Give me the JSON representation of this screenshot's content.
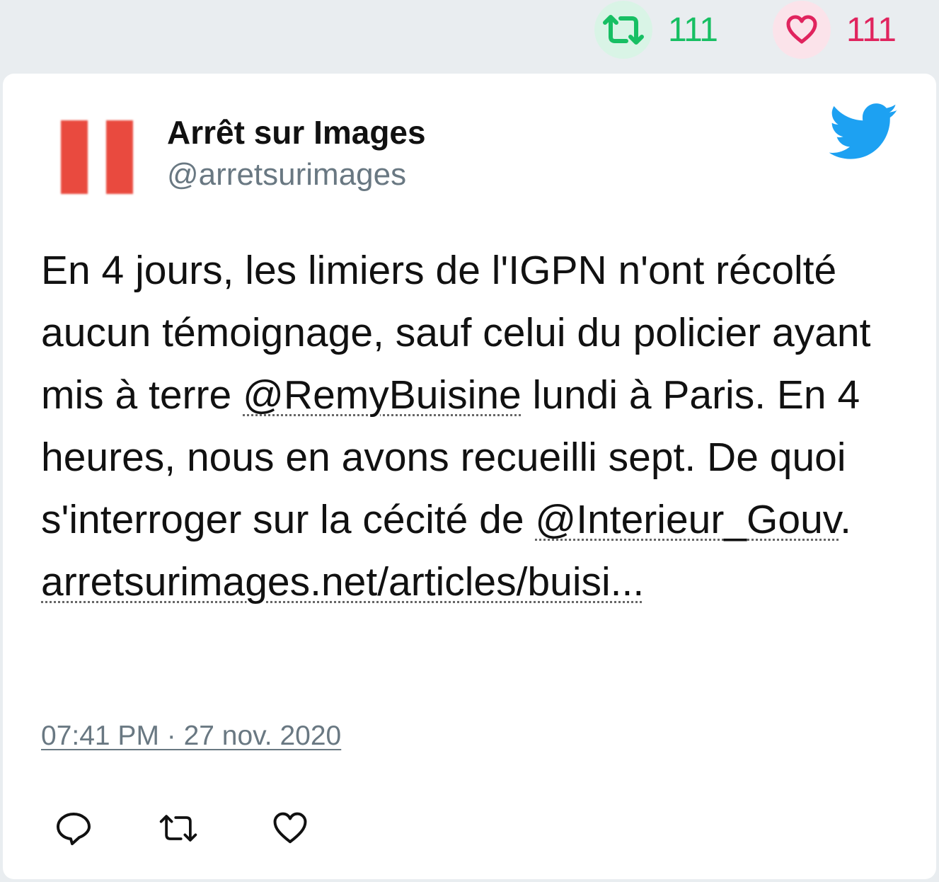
{
  "stats": {
    "retweet_count": "111",
    "like_count": "111",
    "retweet_icon": "retweet-icon",
    "like_icon": "heart-icon"
  },
  "tweet": {
    "author_name": "Arrêt sur Images",
    "author_handle": "@arretsurimages",
    "text_part1": "En 4 jours, les limiers de l'IGPN n'ont récolté aucun témoignage, sauf celui du policier ayant mis à terre ",
    "mention1": "@RemyBuisine",
    "text_part2": " lundi à Paris. En 4 heures, nous en avons recueilli sept. De quoi s'interroger sur la cécité de ",
    "mention2": "@Interieur_Gouv",
    "text_part3": ". ",
    "link": "arretsurimages.net/articles/buisi...",
    "timestamp": "07:41 PM · 27 nov. 2020"
  },
  "colors": {
    "retweet_green": "#17bf63",
    "like_red": "#e0245e",
    "twitter_blue": "#1da1f2",
    "handle_gray": "#697882",
    "avatar_red": "#e94a3f"
  }
}
